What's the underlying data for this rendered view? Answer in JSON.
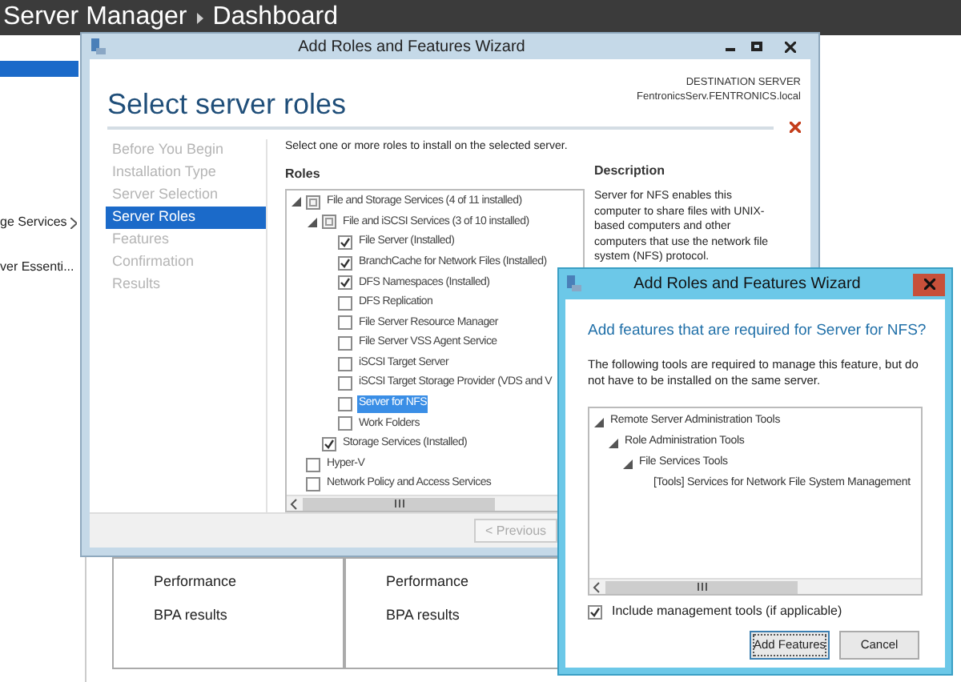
{
  "app": {
    "title": "Server Manager",
    "page": "Dashboard"
  },
  "sidebar": {
    "items": [
      {
        "selected": true,
        "has_arrow": false
      },
      {
        "label": "ge Services",
        "selected": false,
        "has_arrow": true
      },
      {
        "label": "ver Essenti...",
        "selected": false,
        "has_arrow": false
      }
    ]
  },
  "tiles": [
    {
      "rows": [
        "Performance",
        "BPA results"
      ]
    },
    {
      "rows": [
        "Performance",
        "BPA results"
      ]
    }
  ],
  "wizard": {
    "title": "Add Roles and Features Wizard",
    "heading": "Select server roles",
    "destination_label": "DESTINATION SERVER",
    "destination_server": "FentronicsServ.FENTRONICS.local",
    "steps": [
      {
        "label": "Before You Begin",
        "selected": false
      },
      {
        "label": "Installation Type",
        "selected": false
      },
      {
        "label": "Server Selection",
        "selected": false
      },
      {
        "label": "Server Roles",
        "selected": true
      },
      {
        "label": "Features",
        "selected": false
      },
      {
        "label": "Confirmation",
        "selected": false
      },
      {
        "label": "Results",
        "selected": false
      }
    ],
    "instruction": "Select one or more roles to install on the selected server.",
    "roles_label": "Roles",
    "roles": [
      {
        "label": "File and Storage Services (4 of 11 installed)",
        "checked": false,
        "selected": false,
        "expanded": true,
        "children": [
          {
            "label": "File and iSCSI Services (3 of 10 installed)",
            "checked": false,
            "selected": false,
            "expanded": true,
            "children": [
              {
                "label": "File Server (Installed)",
                "checked": true,
                "selected": false
              },
              {
                "label": "BranchCache for Network Files (Installed)",
                "checked": true,
                "selected": false
              },
              {
                "label": "DFS Namespaces (Installed)",
                "checked": true,
                "selected": false
              },
              {
                "label": "DFS Replication",
                "checked": false,
                "selected": false
              },
              {
                "label": "File Server Resource Manager",
                "checked": false,
                "selected": false
              },
              {
                "label": "File Server VSS Agent Service",
                "checked": false,
                "selected": false
              },
              {
                "label": "iSCSI Target Server",
                "checked": false,
                "selected": false
              },
              {
                "label": "iSCSI Target Storage Provider (VDS and V",
                "checked": false,
                "selected": false
              },
              {
                "label": "Server for NFS",
                "checked": false,
                "selected": true
              },
              {
                "label": "Work Folders",
                "checked": false,
                "selected": false
              }
            ]
          },
          {
            "label": "Storage Services (Installed)",
            "checked": true,
            "selected": false
          }
        ]
      },
      {
        "label": "Hyper-V",
        "checked": false,
        "selected": false
      },
      {
        "label": "Network Policy and Access Services",
        "checked": false,
        "selected": false
      }
    ],
    "description_title": "Description",
    "description": "Server for NFS enables this computer to share files with UNIX-based computers and other computers that use the network file system (NFS) protocol.",
    "buttons": [
      {
        "label": "< Previous",
        "disabled": true
      }
    ]
  },
  "dialog": {
    "title": "Add Roles and Features Wizard",
    "question": "Add features that are required for Server for NFS?",
    "explanation": "The following tools are required to manage this feature, but do not have to be installed on the same server.",
    "tree": [
      {
        "label": "Remote Server Administration Tools",
        "expanded": true,
        "children": [
          {
            "label": "Role Administration Tools",
            "expanded": true,
            "children": [
              {
                "label": "File Services Tools",
                "expanded": true,
                "children": [
                  {
                    "label": "[Tools] Services for Network File System Management"
                  }
                ]
              }
            ]
          }
        ]
      }
    ],
    "include_tools": {
      "label": "Include management tools (if applicable)",
      "checked": true
    },
    "buttons": [
      {
        "label": "Add Features",
        "focused": true
      },
      {
        "label": "Cancel",
        "focused": false
      }
    ]
  }
}
